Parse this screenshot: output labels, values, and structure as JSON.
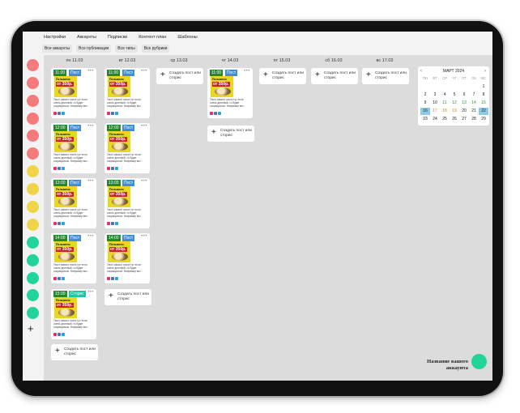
{
  "menu": [
    "Настройки",
    "Аккаунты",
    "Подписки",
    "Контент план",
    "Шаблоны"
  ],
  "filters": [
    "Все аккаунты",
    "Все публикации",
    "Все типы",
    "Все рубрики"
  ],
  "accounts_colors": [
    "#f47b7b",
    "#f47b7b",
    "#f47b7b",
    "#f47b7b",
    "#f47b7b",
    "#f47b7b",
    "#f0d44a",
    "#f0d44a",
    "#f0d44a",
    "#f0d44a",
    "#22d39a",
    "#22d39a",
    "#22d39a",
    "#22d39a",
    "#22d39a"
  ],
  "add_account_symbol": "+",
  "days": [
    "пн 11.03",
    "вт 12.03",
    "ср 13.03",
    "чт 14.03",
    "пт 15.03",
    "сб 16.03",
    "вс 17.03"
  ],
  "post": {
    "type_post": "Пост",
    "type_story": "Сторис",
    "img_line1": "Пельмени",
    "img_line2": "от 350р.",
    "text": "Текст самого поста тут если очень длинный, то будет сокращаться. Например вот...",
    "dots": "•••"
  },
  "times": {
    "mon": [
      "11:00",
      "12:00",
      "13:00",
      "14:00",
      "15:00"
    ],
    "tue": [
      "11:00",
      "12:00",
      "13:00",
      "14:00"
    ],
    "thu": [
      "11:00"
    ]
  },
  "add_label": "Создать пост или сторис",
  "add_symbol": "+",
  "calendar": {
    "month": "МАРТ 2024",
    "prev": "‹",
    "next": "›",
    "weekdays": [
      "ПН",
      "ВТ",
      "СР",
      "ЧТ",
      "ПТ",
      "СБ",
      "ВС"
    ],
    "rows": [
      [
        "",
        "",
        "",
        "",
        "",
        "",
        "1"
      ],
      [
        "2",
        "3",
        "4",
        "5",
        "6",
        "7",
        "8"
      ],
      [
        "9",
        "10",
        "11",
        "12",
        "13",
        "14",
        "15"
      ],
      [
        "16",
        "17",
        "18",
        "19",
        "20",
        "21",
        "22"
      ],
      [
        "23",
        "24",
        "25",
        "26",
        "27",
        "28",
        "29"
      ]
    ],
    "highlight_color": "#8ccbe8"
  },
  "account_name": "Название вашего аккаунта",
  "colors": {
    "post_badge": "#3d8fd6",
    "story_badge": "#22c3a8",
    "time_badge": "#1f8a2e"
  }
}
